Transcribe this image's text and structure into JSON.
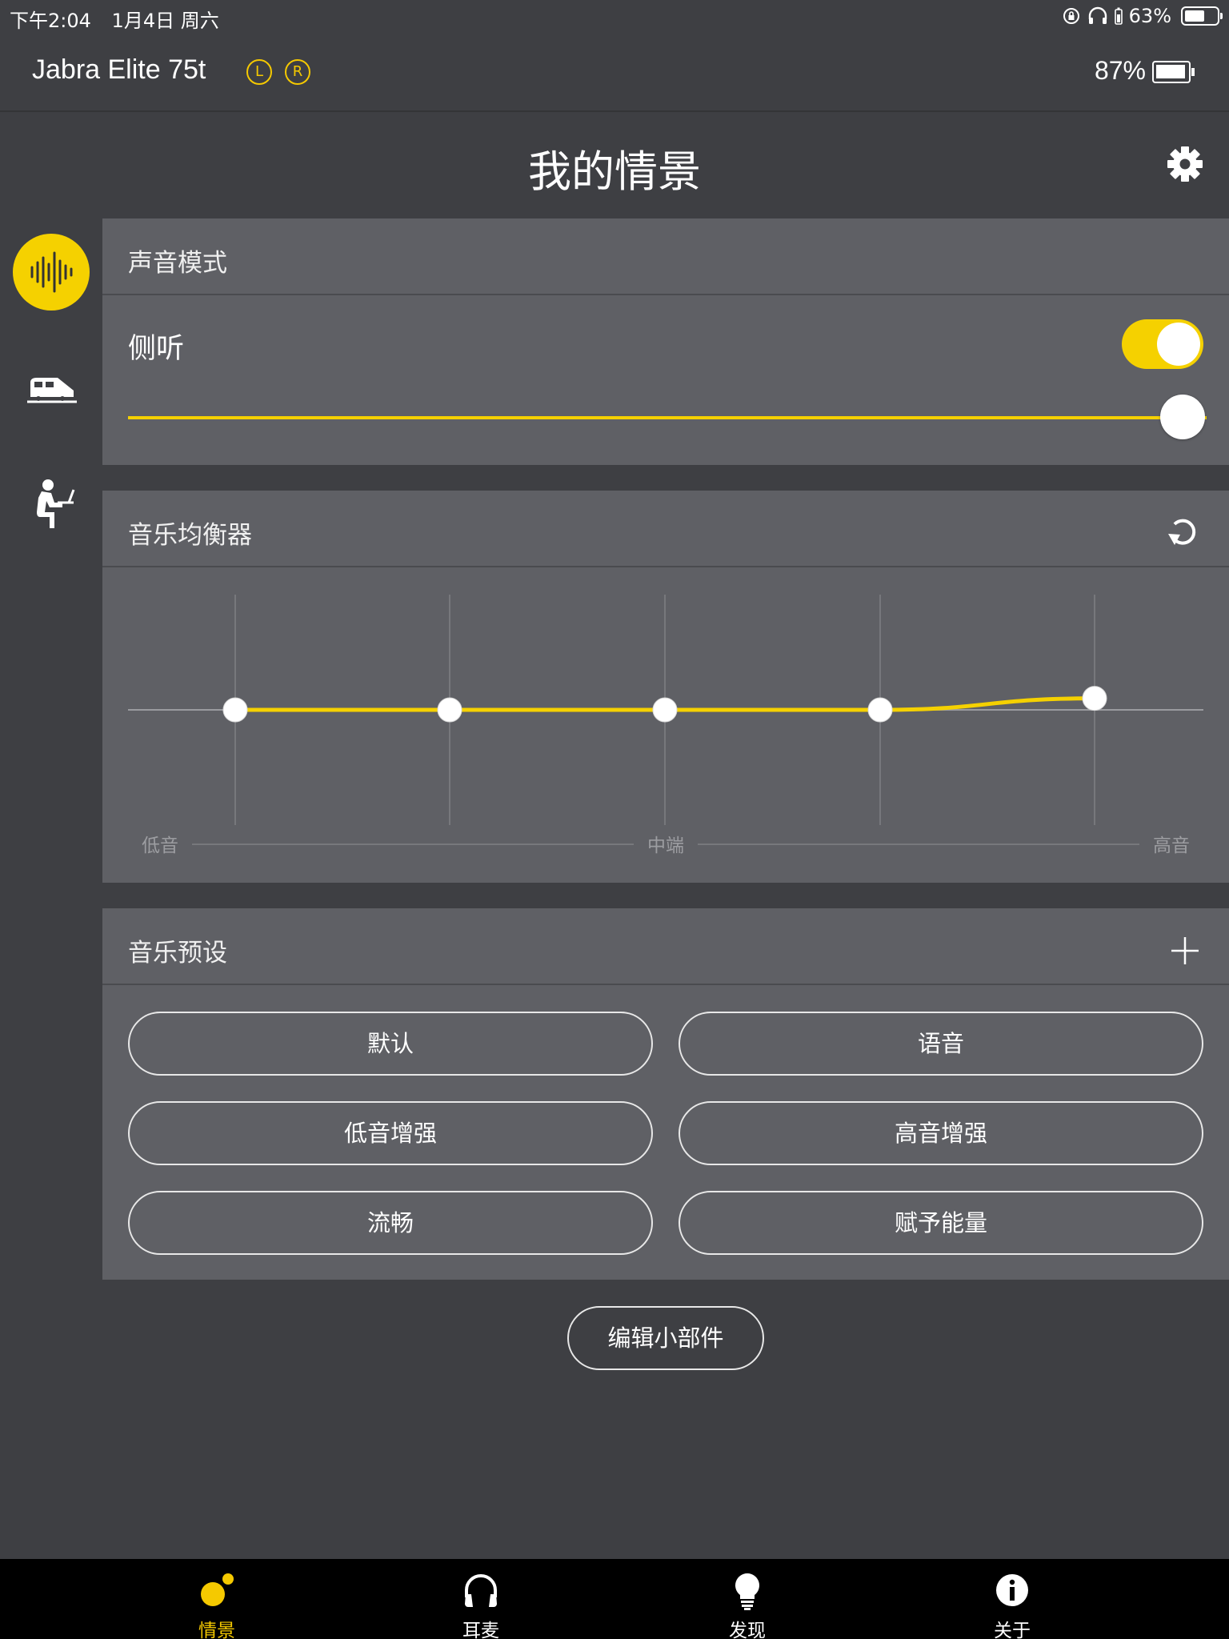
{
  "status_bar": {
    "time": "下午2:04",
    "date": "1月4日 周六",
    "battery": "63%"
  },
  "device": {
    "name": "Jabra Elite 75t",
    "left_badge": "L",
    "right_badge": "R",
    "battery": "87%"
  },
  "page": {
    "title": "我的情景"
  },
  "sound_mode": {
    "title": "声音模式",
    "hearthrough_label": "侧听",
    "hearthrough_on": true,
    "level": 1.0
  },
  "equalizer": {
    "title": "音乐均衡器",
    "label_low": "低音",
    "label_mid": "中端",
    "label_high": "高音",
    "bands": [
      0,
      0,
      0,
      0,
      0.1
    ]
  },
  "presets": {
    "title": "音乐预设",
    "items": [
      "默认",
      "语音",
      "低音增强",
      "高音增强",
      "流畅",
      "赋予能量"
    ]
  },
  "edit_widgets_label": "编辑小部件",
  "tabs": [
    {
      "label": "情景",
      "icon": "moments-icon",
      "active": true
    },
    {
      "label": "耳麦",
      "icon": "headset-icon",
      "active": false
    },
    {
      "label": "发现",
      "icon": "lightbulb-icon",
      "active": false
    },
    {
      "label": "关于",
      "icon": "info-icon",
      "active": false
    }
  ],
  "colors": {
    "accent": "#f5d100",
    "background": "#3e3f43",
    "card": "#5f6065",
    "tabbar": "#000000"
  }
}
